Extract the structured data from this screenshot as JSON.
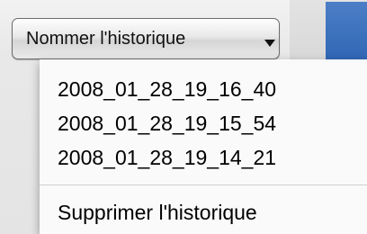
{
  "popup_button": {
    "label": "Nommer l'historique"
  },
  "menu": {
    "history_items": [
      "2008_01_28_19_16_40",
      "2008_01_28_19_15_54",
      "2008_01_28_19_14_21"
    ],
    "clear_label": "Supprimer l'historique"
  },
  "colors": {
    "blue_panel": "#3a6fbb",
    "menu_background": "#fafafa"
  }
}
